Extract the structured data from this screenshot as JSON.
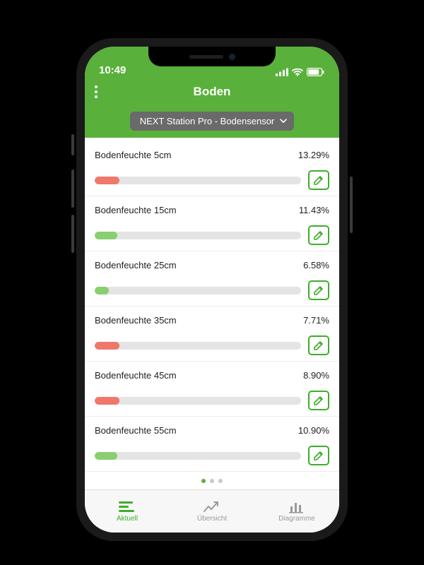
{
  "status": {
    "time": "10:49"
  },
  "header": {
    "title": "Boden"
  },
  "selector": {
    "label": "NEXT Station Pro - Bodensensor"
  },
  "sensors": [
    {
      "label": "Bodenfeuchte 5cm",
      "value": "13.29%",
      "fill_percent": 12,
      "color": "red"
    },
    {
      "label": "Bodenfeuchte 15cm",
      "value": "11.43%",
      "fill_percent": 11,
      "color": "green"
    },
    {
      "label": "Bodenfeuchte 25cm",
      "value": "6.58%",
      "fill_percent": 7,
      "color": "green"
    },
    {
      "label": "Bodenfeuchte 35cm",
      "value": "7.71%",
      "fill_percent": 12,
      "color": "red"
    },
    {
      "label": "Bodenfeuchte 45cm",
      "value": "8.90%",
      "fill_percent": 12,
      "color": "red"
    },
    {
      "label": "Bodenfeuchte 55cm",
      "value": "10.90%",
      "fill_percent": 11,
      "color": "green"
    }
  ],
  "pager": {
    "count": 3,
    "active_index": 0
  },
  "tabs": {
    "aktuell": {
      "label": "Aktuell"
    },
    "ubersicht": {
      "label": "Übersicht"
    },
    "diagramme": {
      "label": "Diagramme"
    }
  },
  "colors": {
    "brand_green": "#59b13b",
    "accent_green": "#3fae2a",
    "bar_red": "#f0776c",
    "bar_green": "#89cf6f"
  }
}
